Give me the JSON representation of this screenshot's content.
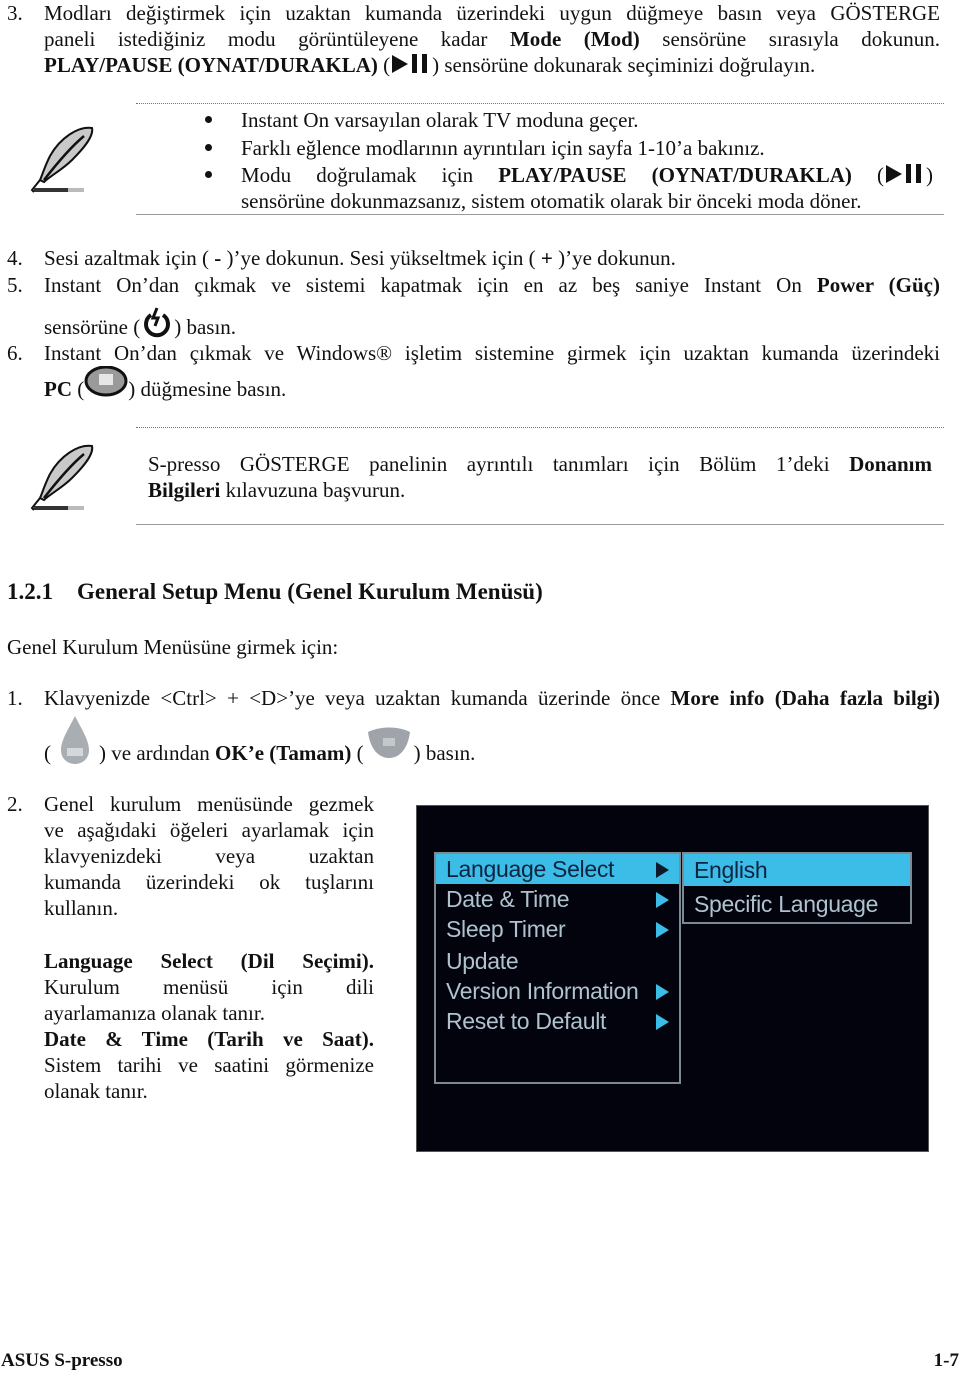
{
  "step3": {
    "number": "3.",
    "line1": "Modları değiştirmek için uzaktan kumanda üzerindeki uygun düğmeye basın veya GÖSTERGE",
    "line2_pre": "paneli istediğiniz modu görüntüleyene kadar ",
    "line2_bold": "Mode (Mod)",
    "line2_post": " sensörüne sırasıyla dokunun.",
    "line3_bold": "PLAY/PAUSE (OYNAT/DURAKLA)",
    "line3_open": " (",
    "line3_post": ") sensörüne dokunarak seçiminizi doğrulayın."
  },
  "note1": {
    "bullets": [
      "Instant On varsayılan olarak TV moduna geçer.",
      "Farklı eğlence modlarının ayrıntıları için sayfa 1-10’a bakınız."
    ],
    "bullet3_pre": "Modu doğrulamak için ",
    "bullet3_bold": "PLAY/PAUSE (OYNAT/DURAKLA)",
    "bullet3_open": " (",
    "bullet3_close": ")",
    "bullet3_line2": "sensörüne dokunmazsanız, sistem otomatik olarak bir önceki moda döner."
  },
  "step4": {
    "number": "4.",
    "text_a": "Sesi azaltmak için (",
    "minus": " - ",
    "text_b": ")’ye dokunun. Sesi yükseltmek için (",
    "plus": " + ",
    "text_c": ")’ye dokunun."
  },
  "step5": {
    "number": "5.",
    "line1_pre": "Instant On’dan çıkmak ve sistemi kapatmak için en az beş saniye Instant On ",
    "line1_bold": "Power (Güç)",
    "line2_pre": "sensörüne (",
    "line2_post": ") basın."
  },
  "step6": {
    "number": "6.",
    "line1": "Instant On’dan çıkmak ve Windows® işletim sistemine girmek için uzaktan kumanda üzerindeki",
    "line2_bold": "PC",
    "line2_open": " (",
    "line2_post": ") düğmesine basın."
  },
  "note2": {
    "line1_pre": "S-presso GÖSTERGE panelinin ayrıntılı tanımları için Bölüm 1’deki ",
    "line1_bold": "Donanım",
    "line2_bold": "Bilgileri",
    "line2_post": " kılavuzuna başvurun."
  },
  "section": {
    "number": "1.2.1",
    "title": "General Setup Menu (Genel Kurulum Menüsü)",
    "intro": "Genel Kurulum Menüsüne girmek için:"
  },
  "setup_step1": {
    "number": "1.",
    "line1_pre": "Klavyenizde <Ctrl> + <D>’ye veya uzaktan kumanda üzerinde önce ",
    "line1_bold": "More info (Daha fazla bilgi)",
    "line2_open": "(",
    "line2_mid": ") ve ardından ",
    "line2_bold": "OK’e (Tamam)",
    "line2_open2": " (",
    "line2_post": ") basın."
  },
  "setup_step2": {
    "number": "2.",
    "lines": [
      "Genel kurulum menüsünde gezmek",
      "ve aşağıdaki öğeleri ayarlamak için",
      "klavyenizdeki veya uzaktan",
      "kumanda üzerindeki ok tuşlarını",
      "kullanın."
    ],
    "lang_bold": "Language Select (Dil Seçimi).",
    "lang_lines": [
      "Kurulum menüsü için dili",
      "ayarlamanıza olanak tanır."
    ],
    "date_bold": "Date & Time (Tarih ve Saat).",
    "date_lines": [
      "Sistem tarihi ve saatini görmenize",
      "olanak tanır."
    ]
  },
  "tv_menu": {
    "accent": "#3cbde8",
    "items": [
      {
        "label": "Language Select",
        "selected": true,
        "submenu": true
      },
      {
        "label": "Date & Time",
        "selected": false,
        "submenu": true
      },
      {
        "label": "Sleep Timer",
        "selected": false,
        "submenu": true
      },
      {
        "label": "Update",
        "selected": false,
        "submenu": false
      },
      {
        "label": "Version Information",
        "selected": false,
        "submenu": true
      },
      {
        "label": "Reset to Default",
        "selected": false,
        "submenu": true
      }
    ],
    "submenu": [
      {
        "label": "English",
        "selected": true
      },
      {
        "label": "Specific Language",
        "selected": false
      }
    ]
  },
  "footer": {
    "left": "ASUS S-presso",
    "right": "1-7"
  }
}
